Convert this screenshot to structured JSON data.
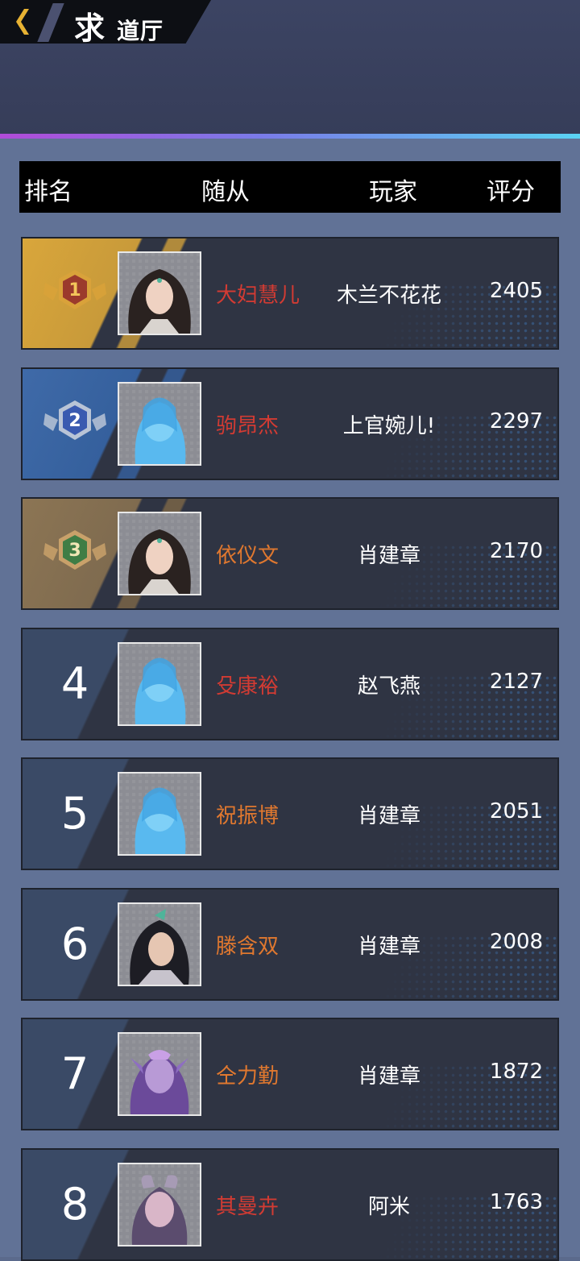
{
  "header": {
    "title_big": "求",
    "title_small": "道厅"
  },
  "columns": {
    "rank": "排名",
    "companion": "随从",
    "player": "玩家",
    "score": "评分"
  },
  "rows": [
    {
      "rank": "1",
      "companion": "大妇慧儿",
      "player": "木兰不花花",
      "score": "2405",
      "name_color": "#d23b33",
      "badge": "gold",
      "portrait": "woman-dark-hair"
    },
    {
      "rank": "2",
      "companion": "驹昂杰",
      "player": "上官婉儿!",
      "score": "2297",
      "name_color": "#d23b33",
      "badge": "silver",
      "portrait": "blue-hologram"
    },
    {
      "rank": "3",
      "companion": "依仪文",
      "player": "肖建章",
      "score": "2170",
      "name_color": "#e0782f",
      "badge": "bronze",
      "portrait": "woman-dark-hair"
    },
    {
      "rank": "4",
      "companion": "殳康裕",
      "player": "赵飞燕",
      "score": "2127",
      "name_color": "#d23b33",
      "portrait": "blue-hologram"
    },
    {
      "rank": "5",
      "companion": "祝振博",
      "player": "肖建章",
      "score": "2051",
      "name_color": "#e0782f",
      "portrait": "blue-hologram"
    },
    {
      "rank": "6",
      "companion": "滕含双",
      "player": "肖建章",
      "score": "2008",
      "name_color": "#e0782f",
      "portrait": "warrior-black-hair"
    },
    {
      "rank": "7",
      "companion": "仝力勤",
      "player": "肖建章",
      "score": "1872",
      "name_color": "#e0782f",
      "portrait": "purple-siren"
    },
    {
      "rank": "8",
      "companion": "其曼卉",
      "player": "阿米",
      "score": "1763",
      "name_color": "#d23b33",
      "portrait": "purple-horned"
    }
  ]
}
